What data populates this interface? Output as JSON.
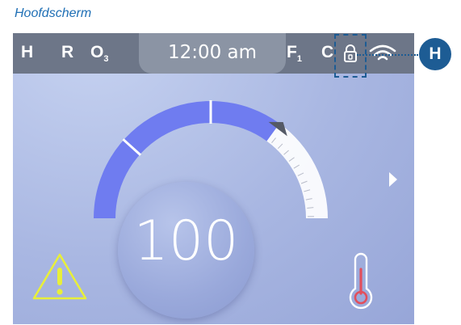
{
  "caption": "Hoofdscherm",
  "status_bar": {
    "h_label": "H",
    "r_label": "R",
    "ozone_label": "O",
    "ozone_sub": "3",
    "time": "12:00 am",
    "filter_label": "F",
    "filter_sub": "1",
    "c_label": "C",
    "lock_icon": "lock-icon",
    "wifi_icon": "wifi-icon"
  },
  "callout": {
    "letter": "H"
  },
  "dial": {
    "value": "100",
    "level_fraction": 0.7,
    "colors": {
      "filled": "#6f7cf0",
      "track": "#ffffff",
      "pointer": "#555a66"
    }
  },
  "icons": {
    "warning": "warning-icon",
    "thermometer": "thermometer-icon",
    "next": "chevron-right-icon"
  },
  "colors": {
    "topbar": "#6d7688",
    "timebox": "#8b94a4",
    "warning": "#e8ef3a",
    "thermometer": "#e24f5c",
    "accent": "#1d5c94"
  }
}
